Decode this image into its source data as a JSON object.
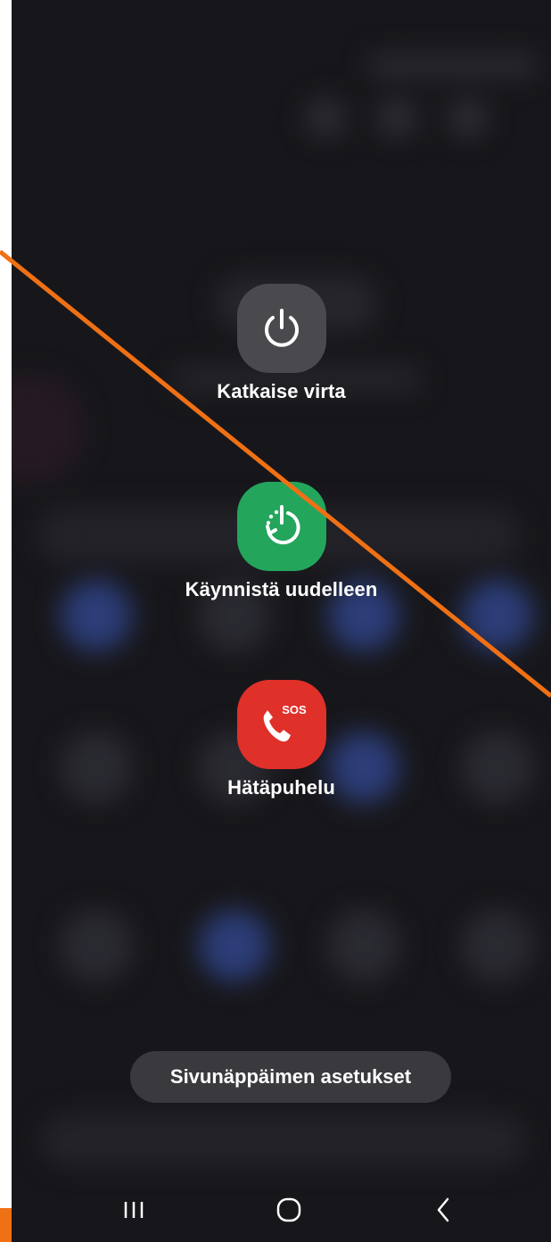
{
  "power_menu": {
    "items": [
      {
        "label": "Katkaise virta",
        "icon": "power-icon",
        "color": "#4a4a4e"
      },
      {
        "label": "Käynnistä uudelleen",
        "icon": "restart-icon",
        "color": "#23a55c"
      },
      {
        "label": "Hätäpuhelu",
        "icon": "emergency-sos-icon",
        "color": "#e0302a",
        "badge": "SOS"
      }
    ],
    "side_key_settings": "Sivunäppäimen asetukset"
  },
  "navbar": {
    "recents_icon": "recents-icon",
    "home_icon": "home-icon",
    "back_icon": "back-icon"
  },
  "overlay": {
    "annotation_color": "#f07014"
  }
}
